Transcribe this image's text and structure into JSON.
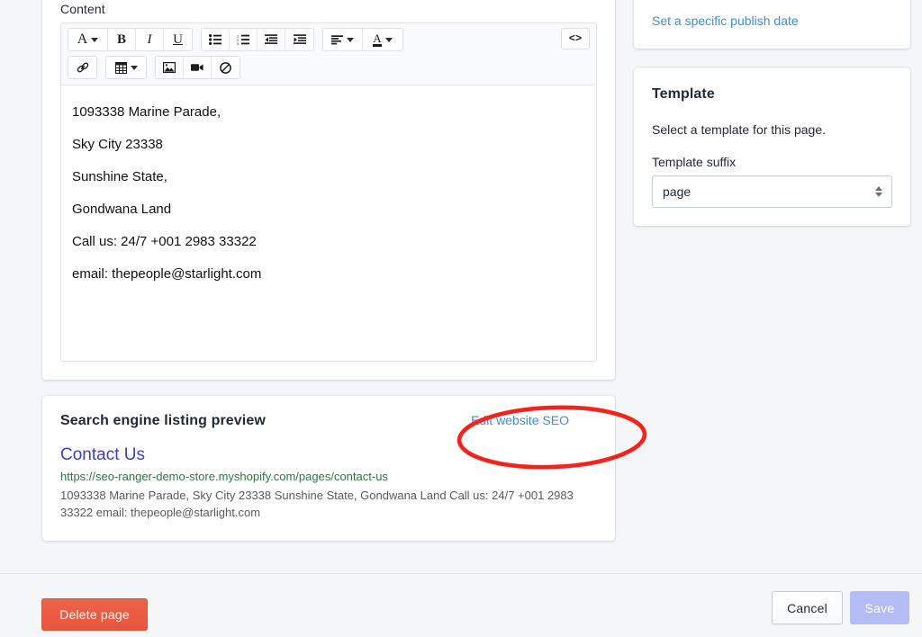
{
  "main": {
    "content_card": {
      "label": "Content",
      "toolbar": {
        "row1": [
          {
            "name": "font-family-icon",
            "glyph": "A",
            "caret": true
          },
          {
            "name": "bold-icon",
            "glyph": "B",
            "caret": false
          },
          {
            "name": "italic-icon",
            "glyph": "I",
            "caret": false
          },
          {
            "name": "underline-icon",
            "glyph": "U",
            "caret": false
          },
          {
            "name": "bulleted-list-icon",
            "glyph": "",
            "caret": false
          },
          {
            "name": "numbered-list-icon",
            "glyph": "",
            "caret": false
          },
          {
            "name": "outdent-icon",
            "glyph": "",
            "caret": false
          },
          {
            "name": "indent-icon",
            "glyph": "",
            "caret": false
          },
          {
            "name": "align-icon",
            "glyph": "",
            "caret": true
          },
          {
            "name": "text-color-icon",
            "glyph": "A",
            "caret": true
          }
        ],
        "row2": [
          {
            "name": "link-icon"
          },
          {
            "name": "table-icon"
          },
          {
            "name": "image-icon"
          },
          {
            "name": "video-icon"
          },
          {
            "name": "clear-formatting-icon"
          }
        ],
        "code_view_label": "<>"
      },
      "body_lines": [
        "1093338 Marine Parade,",
        "Sky City 23338",
        "Sunshine State,",
        "Gondwana Land",
        "Call us: 24/7 +001 2983 33322",
        "email: thepeople@starlight.com"
      ]
    },
    "seo_card": {
      "title": "Search engine listing preview",
      "edit_link": "Edit website SEO",
      "preview_title": "Contact Us",
      "preview_url": "https://seo-ranger-demo-store.myshopify.com/pages/contact-us",
      "preview_description": "1093338 Marine Parade, Sky City 23338 Sunshine State, Gondwana Land Call us: 24/7 +001 2983 33322 email: thepeople@starlight.com"
    }
  },
  "sidebar": {
    "visibility_card": {
      "publish_date_link": "Set a specific publish date"
    },
    "template_card": {
      "title": "Template",
      "description": "Select a template for this page.",
      "suffix_label": "Template suffix",
      "suffix_value": "page"
    }
  },
  "footer": {
    "delete_label": "Delete page",
    "cancel_label": "Cancel",
    "save_label": "Save"
  },
  "annotation": {
    "shape": "ellipse",
    "color": "#f8221c",
    "target": "Edit website SEO"
  },
  "colors": {
    "background": "#f4f6f8",
    "link_blue": "#3f8ed4",
    "delete_red": "#e8553c",
    "save_disabled": "#b3bcf5",
    "seo_title_blue": "#3d3dcc",
    "seo_url_green": "#277c3c",
    "annotation_red": "#f8221c"
  }
}
